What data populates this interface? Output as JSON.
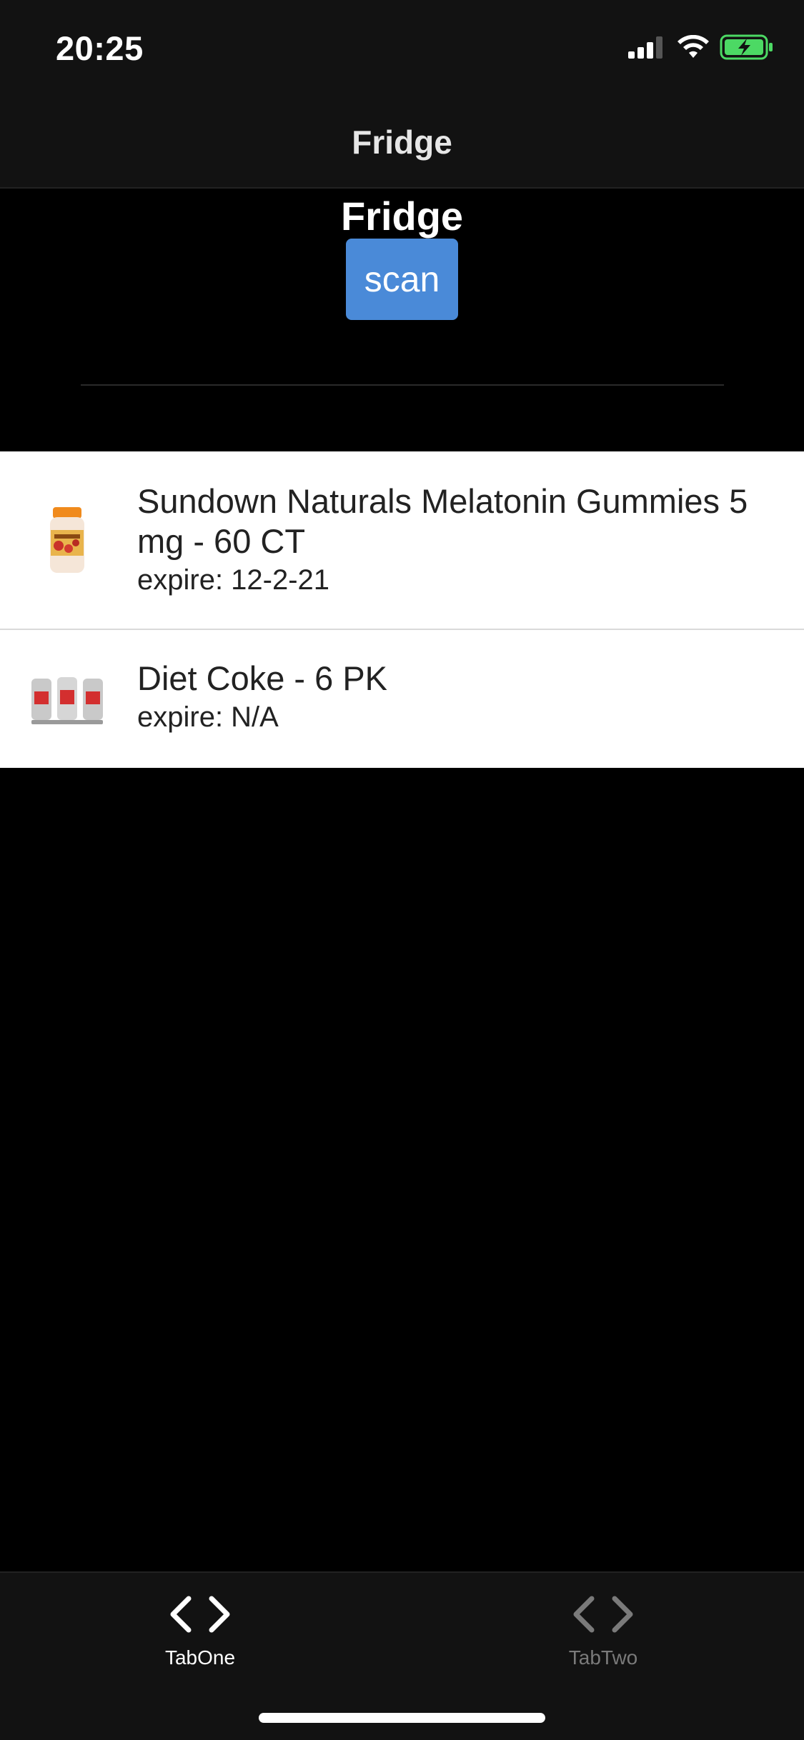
{
  "status_bar": {
    "time": "20:25",
    "icons": [
      "cellular-signal-icon",
      "wifi-icon",
      "battery-charging-icon"
    ],
    "battery_color": "#4cd964"
  },
  "nav": {
    "title": "Fridge"
  },
  "header": {
    "title": "Fridge",
    "scan_label": "scan",
    "scan_color": "#4a8ad8"
  },
  "items": [
    {
      "name": "Sundown Naturals Melatonin Gummies 5 mg - 60 CT",
      "expire": "expire: 12-2-21",
      "icon": "melatonin-gummies-bottle-icon"
    },
    {
      "name": "Diet Coke - 6 PK",
      "expire": "expire: N/A",
      "icon": "diet-coke-six-pack-icon"
    }
  ],
  "tabs": [
    {
      "label": "TabOne",
      "icon": "code-brackets-icon",
      "active": true
    },
    {
      "label": "TabTwo",
      "icon": "code-brackets-icon",
      "active": false
    }
  ]
}
